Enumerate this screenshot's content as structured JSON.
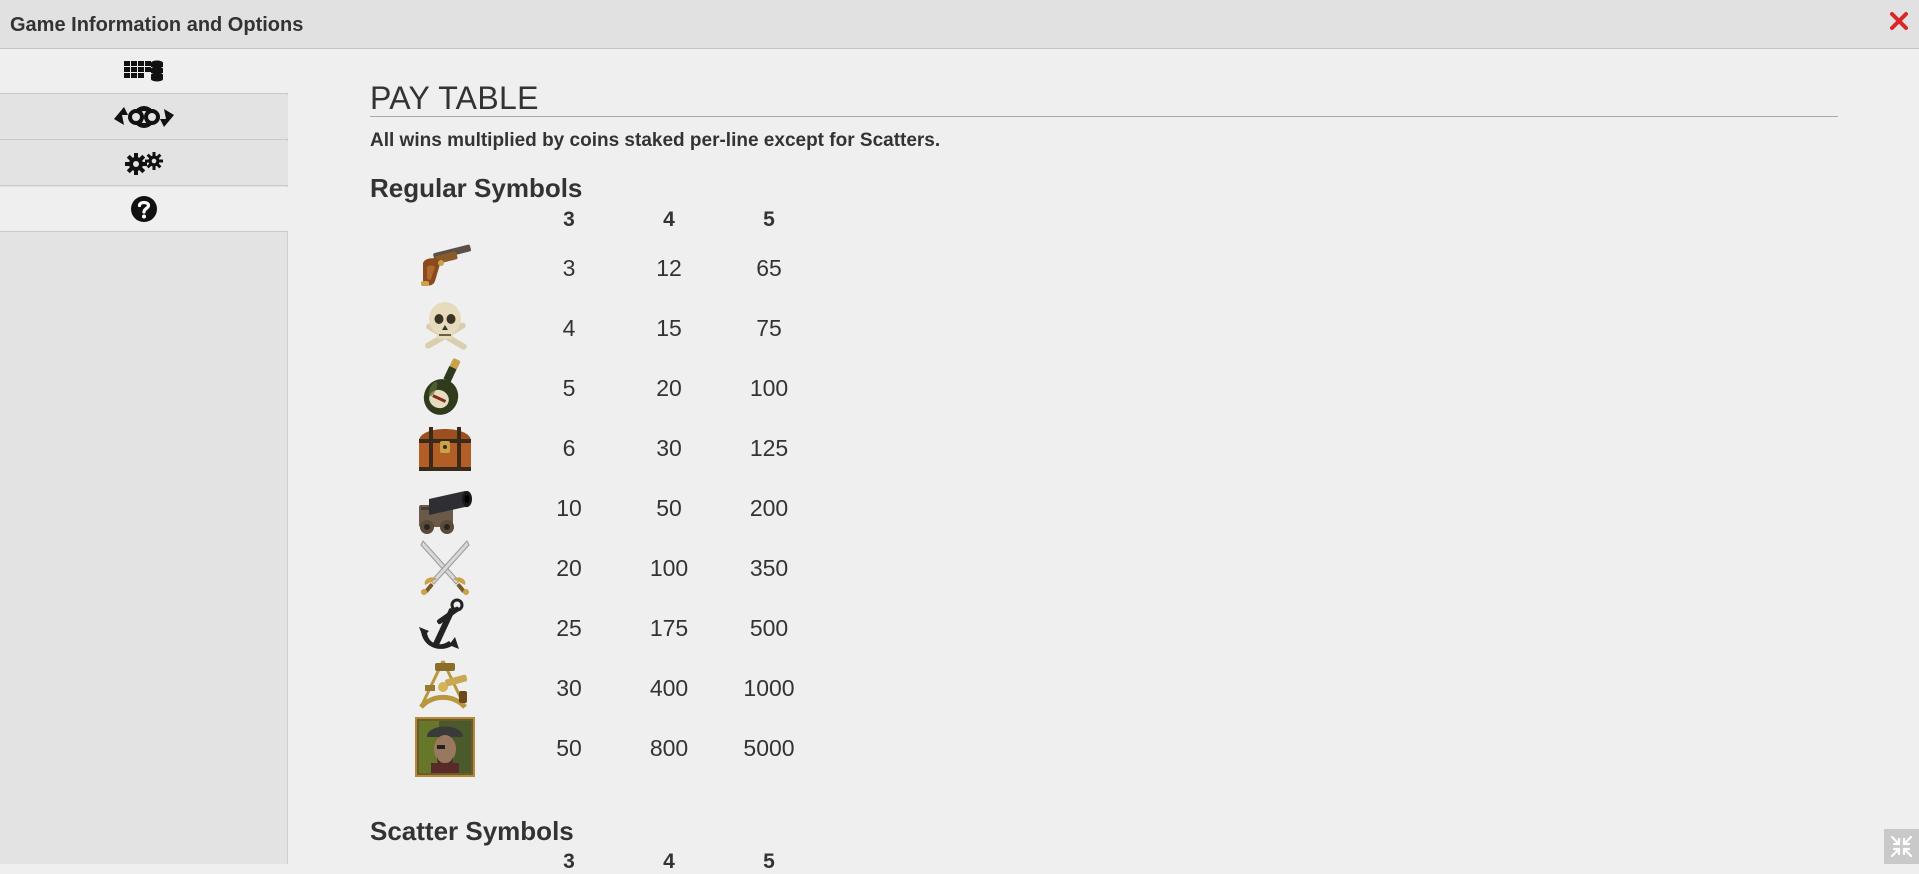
{
  "window": {
    "title": "Game Information and Options"
  },
  "sidebar": {
    "items": [
      {
        "icon": "paytable-icon"
      },
      {
        "icon": "autoplay-icon"
      },
      {
        "icon": "settings-gears-icon"
      },
      {
        "icon": "help-icon",
        "active": true
      }
    ]
  },
  "paytable": {
    "title": "PAY TABLE",
    "subtitle": "All wins multiplied by coins staked per-line except for Scatters.",
    "regular_heading": "Regular Symbols",
    "scatter_heading": "Scatter Symbols",
    "columns": [
      "3",
      "4",
      "5"
    ],
    "rows": [
      {
        "symbol": "flintlock-pistol-icon",
        "values": [
          "3",
          "12",
          "65"
        ]
      },
      {
        "symbol": "skull-crossbones-icon",
        "values": [
          "4",
          "15",
          "75"
        ]
      },
      {
        "symbol": "rum-bottle-icon",
        "values": [
          "5",
          "20",
          "100"
        ]
      },
      {
        "symbol": "treasure-chest-icon",
        "values": [
          "6",
          "30",
          "125"
        ]
      },
      {
        "symbol": "cannon-icon",
        "values": [
          "10",
          "50",
          "200"
        ]
      },
      {
        "symbol": "crossed-swords-icon",
        "values": [
          "20",
          "100",
          "350"
        ]
      },
      {
        "symbol": "anchor-icon",
        "values": [
          "25",
          "175",
          "500"
        ]
      },
      {
        "symbol": "sextant-icon",
        "values": [
          "30",
          "400",
          "1000"
        ]
      },
      {
        "symbol": "pirate-wild-icon",
        "values": [
          "50",
          "800",
          "5000"
        ]
      }
    ],
    "scatter_columns": [
      "3",
      "4",
      "5"
    ]
  },
  "colors": {
    "close": "#d9262b",
    "background": "#efefef",
    "titlebar": "#e1e1e1"
  }
}
